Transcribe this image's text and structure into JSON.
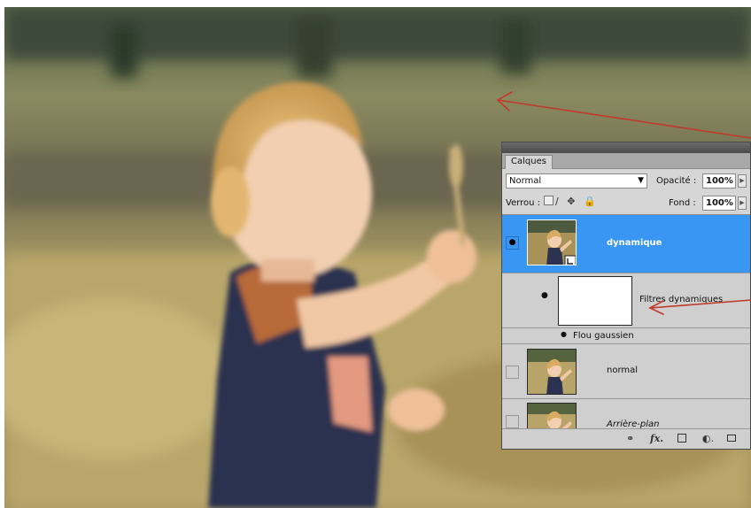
{
  "layers_panel": {
    "tab_label": "Calques",
    "blend_mode": "Normal",
    "opacity_label": "Opacité :",
    "opacity_value": "100%",
    "lock_label": "Verrou :",
    "fill_label": "Fond :",
    "fill_value": "100%",
    "layers": [
      {
        "name": "dynamique",
        "selected": true,
        "visible": true,
        "smart_object": true
      },
      {
        "name": "Filtres dynamiques",
        "type": "smart-filter-mask",
        "visible": true
      },
      {
        "name": "Flou gaussien",
        "type": "filter",
        "visible": true
      },
      {
        "name": "normal",
        "selected": false,
        "visible": false
      },
      {
        "name": "Arrière-plan",
        "selected": false,
        "visible": false,
        "italic": true
      }
    ],
    "bottom_icons": [
      "link-icon",
      "fx-icon",
      "mask-icon",
      "adjustment-icon",
      "folder-icon"
    ],
    "fx_label": "fx."
  },
  "colors": {
    "selection": "#3996f3",
    "annotation_arrow": "#c0392b",
    "panel_bg": "#d6d6d6"
  }
}
